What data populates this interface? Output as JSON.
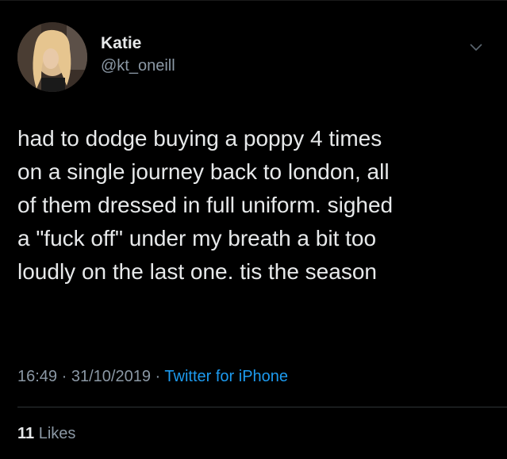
{
  "tweet": {
    "author": {
      "display_name": "Katie",
      "handle": "@kt_oneill",
      "avatar_icon": "profile-photo"
    },
    "menu_icon": "chevron-down-icon",
    "text": "had to dodge buying a poppy 4 times\non a single journey back to london, all\nof them dressed in full uniform. sighed\na \"fuck off\" under my breath a bit too\nloudly on the last one. tis the season",
    "time": "16:49",
    "separator": "·",
    "date": "31/10/2019",
    "source": "Twitter for iPhone",
    "likes": {
      "count": "11",
      "label": "Likes"
    }
  },
  "colors": {
    "background": "#000000",
    "text": "#e7e9ea",
    "secondary": "#8b98a5",
    "link": "#1d9bf0",
    "divider": "#2f3336"
  }
}
